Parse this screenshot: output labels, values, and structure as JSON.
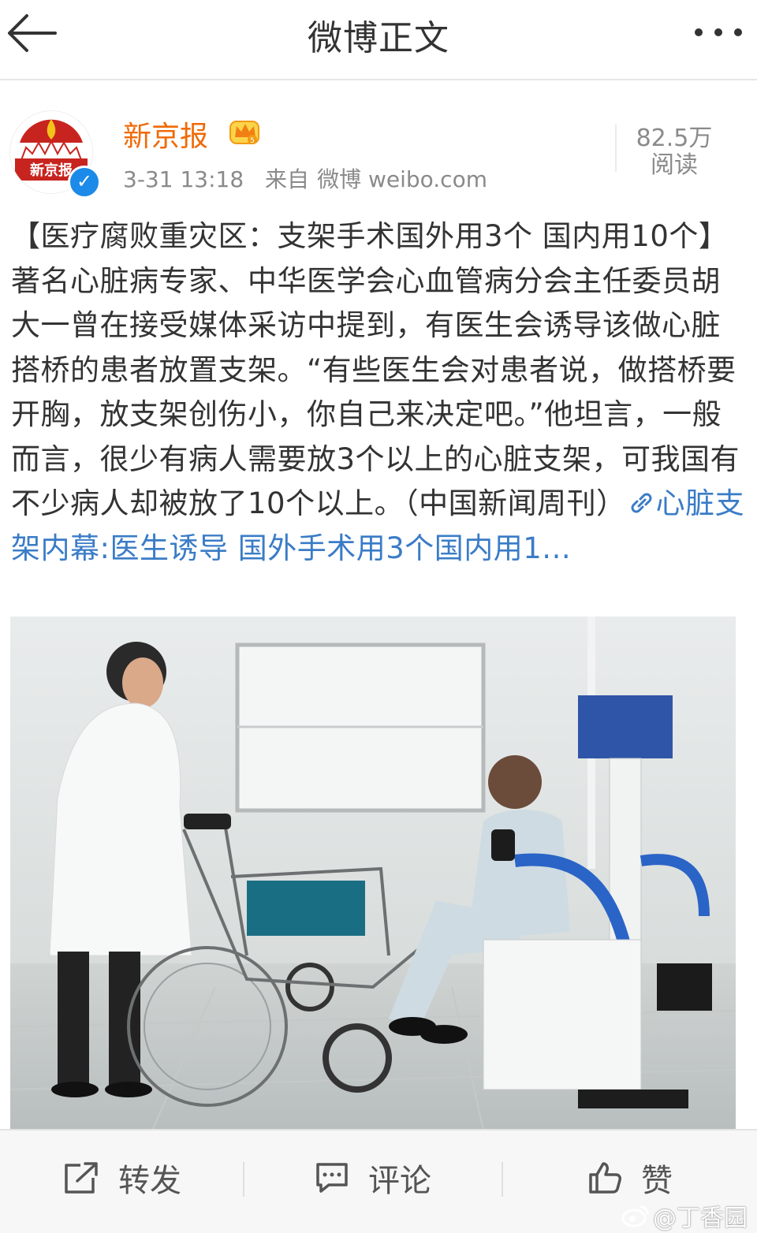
{
  "nav": {
    "title": "微博正文"
  },
  "post": {
    "author": "新京报",
    "avatar_text": "新京报",
    "timestamp": "3-31 13:18",
    "source_prefix": "来自",
    "source": "微博 weibo.com",
    "read_count": "82.5万",
    "read_label": "阅读",
    "body": "【医疗腐败重灾区：支架手术国外用3个 国内用10个】著名心脏病专家、中华医学会心血管病分会主任委员胡大一曾在接受媒体采访中提到，有医生会诱导该做心脏搭桥的患者放置支架。“有些医生会对患者说，做搭桥要开胸，放支架创伤小，你自己来决定吧。”他坦言，一般而言，很少有病人需要放3个以上的心脏支架，可我国有不少病人却被放了10个以上。（中国新闻周刊）",
    "link_text": "心脏支架内幕:医生诱导 国外手术用3个国内用1...",
    "image_icon": "photo-rehab-room-icon"
  },
  "actions": {
    "repost": "转发",
    "comment": "评论",
    "like": "赞"
  },
  "watermark": "@丁香园",
  "colors": {
    "author": "#f06a06",
    "link": "#3a7cc7",
    "verified": "#1c8ae8"
  }
}
